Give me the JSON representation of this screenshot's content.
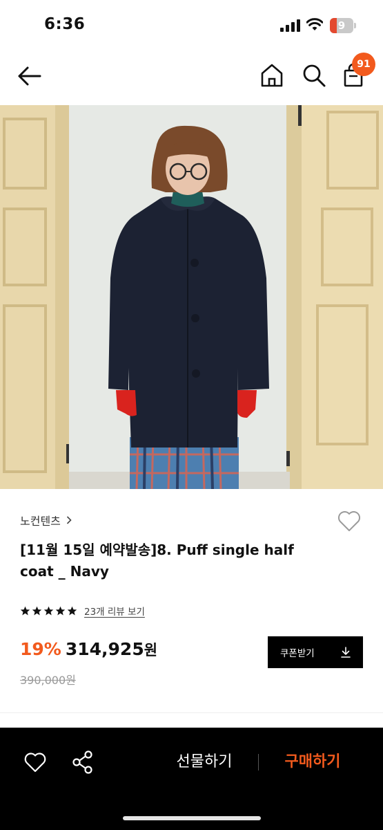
{
  "status_bar": {
    "time": "6:36",
    "battery_level": "9",
    "icons": [
      "signal-icon",
      "wifi-icon",
      "battery-icon"
    ]
  },
  "nav": {
    "icons": [
      "back-arrow-icon",
      "home-icon",
      "search-icon",
      "shopping-bag-icon"
    ],
    "cart_count": "91"
  },
  "product": {
    "brand": "노컨텐츠",
    "title": "[11월 15일 예약발송]8. Puff single half coat _ Navy",
    "rating_stars": 5,
    "review_text": "23개 리뷰 보기",
    "discount_rate": "19%",
    "sale_price": "314,925",
    "currency": "원",
    "original_price": "390,000원",
    "coupon_label": "쿠폰받기"
  },
  "bottom_bar": {
    "gift_label": "선물하기",
    "buy_label": "구매하기",
    "icons": [
      "heart-icon",
      "share-icon"
    ]
  },
  "colors": {
    "accent": "#f25a1d",
    "coat": "#1c2233",
    "background_wall": "#e9ebe7",
    "door": "#e8d7ab"
  }
}
